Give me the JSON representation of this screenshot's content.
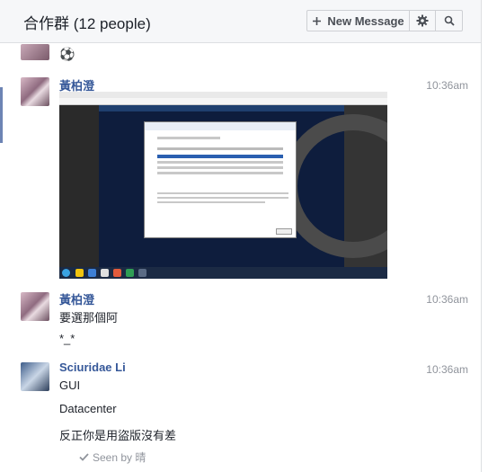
{
  "header": {
    "title": "合作群 (12 people)",
    "new_message_label": "New Message",
    "settings_icon": "gear-icon",
    "search_icon": "search-icon"
  },
  "messages": [
    {
      "sender": "",
      "time": "",
      "lines": [
        "⚽"
      ]
    },
    {
      "sender": "黃柏澄",
      "time": "10:36am",
      "lines": [],
      "attachment": "screenshot-image"
    },
    {
      "sender": "黃柏澄",
      "time": "10:36am",
      "lines": [
        "要選那個阿",
        "*_*"
      ]
    },
    {
      "sender": "Sciuridae Li",
      "time": "10:36am",
      "lines": [
        "GUI",
        "Datacenter",
        "反正你是用盜版沒有差"
      ]
    }
  ],
  "seen": {
    "label": "Seen by 晴",
    "icon": "checkmark-icon"
  },
  "colors": {
    "header_bg": "#f6f7f9",
    "sender_link": "#365899",
    "timestamp": "#90949c",
    "accent": "#6d84b4"
  }
}
